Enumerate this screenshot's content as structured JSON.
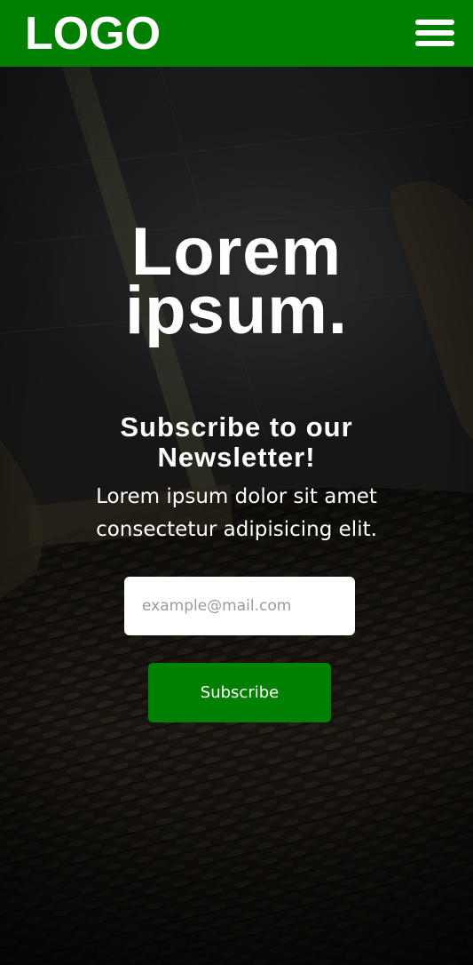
{
  "header": {
    "logo_text": "LOGO",
    "menu_icon": "hamburger-menu-icon",
    "background_color": "#008000"
  },
  "hero": {
    "title_line1": "Lorem",
    "title_line2": "ipsum.",
    "newsletter_heading_line1": "Subscribe to our",
    "newsletter_heading_line2": "Newsletter!",
    "description_line1": "Lorem ipsum dolor sit amet",
    "description_line2": "consectetur adipisicing elit."
  },
  "form": {
    "email_placeholder": "example@mail.com",
    "email_value": "",
    "subscribe_label": "Subscribe",
    "button_color": "#008000"
  }
}
